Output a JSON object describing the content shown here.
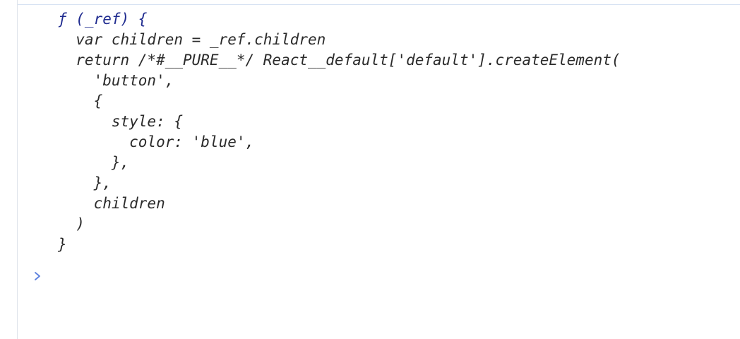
{
  "console": {
    "function_source": {
      "lines": [
        "ƒ (_ref) {",
        "  var children = _ref.children",
        "  return /*#__PURE__*/ React__default['default'].createElement(",
        "    'button',",
        "    {",
        "      style: {",
        "        color: 'blue',",
        "      },",
        "    },",
        "    children",
        "  )",
        "}"
      ]
    },
    "prompt": {
      "icon": "chevron-right-icon",
      "input_value": "",
      "input_placeholder": ""
    },
    "colors": {
      "prompt_icon": "#5b7fde",
      "function_keyword": "#1f2b8f",
      "code_text": "#2b2b2b",
      "divider": "#d6e2f3"
    }
  }
}
